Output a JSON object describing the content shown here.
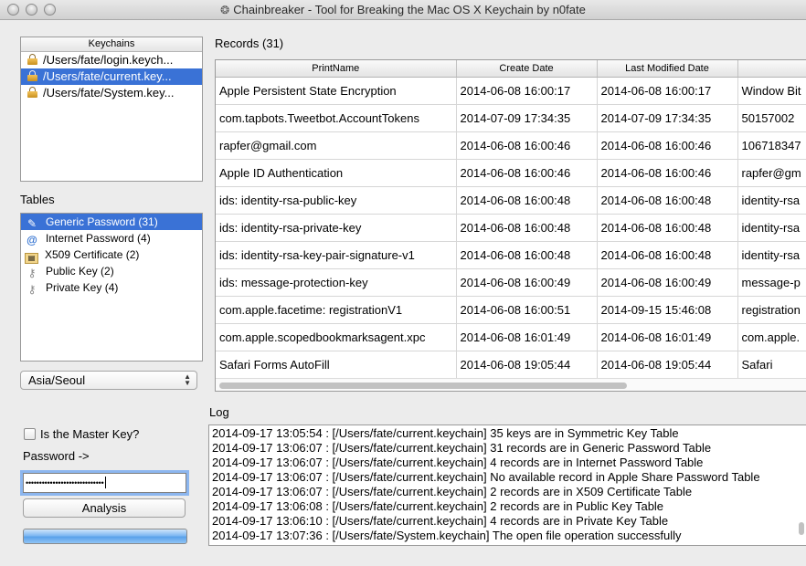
{
  "window": {
    "title": "Chainbreaker - Tool for Breaking the Mac OS X Keychain by n0fate"
  },
  "keychains": {
    "header": "Keychains",
    "items": [
      {
        "label": "/Users/fate/login.keych..."
      },
      {
        "label": "/Users/fate/current.key..."
      },
      {
        "label": "/Users/fate/System.key..."
      }
    ],
    "selected_index": 1
  },
  "tables": {
    "label": "Tables",
    "items": [
      {
        "label": "Generic Password (31)",
        "icon": "pen-icon"
      },
      {
        "label": "Internet Password (4)",
        "icon": "at-icon"
      },
      {
        "label": "X509 Certificate (2)",
        "icon": "certificate-icon"
      },
      {
        "label": "Public Key (2)",
        "icon": "key-icon"
      },
      {
        "label": "Private Key (4)",
        "icon": "key-icon"
      }
    ],
    "selected_index": 0
  },
  "timezone": {
    "value": "Asia/Seoul"
  },
  "records": {
    "label": "Records (31)",
    "columns": [
      "PrintName",
      "Create Date",
      "Last Modified Date",
      ""
    ],
    "rows": [
      [
        "Apple Persistent State Encryption",
        "2014-06-08 16:00:17",
        "2014-06-08 16:00:17",
        "Window Bit"
      ],
      [
        "com.tapbots.Tweetbot.AccountTokens",
        "2014-07-09 17:34:35",
        "2014-07-09 17:34:35",
        "50157002"
      ],
      [
        "rapfer@gmail.com",
        "2014-06-08 16:00:46",
        "2014-06-08 16:00:46",
        "106718347"
      ],
      [
        "Apple ID Authentication",
        "2014-06-08 16:00:46",
        "2014-06-08 16:00:46",
        "rapfer@gm"
      ],
      [
        "ids: identity-rsa-public-key",
        "2014-06-08 16:00:48",
        "2014-06-08 16:00:48",
        "identity-rsa"
      ],
      [
        "ids: identity-rsa-private-key",
        "2014-06-08 16:00:48",
        "2014-06-08 16:00:48",
        "identity-rsa"
      ],
      [
        "ids: identity-rsa-key-pair-signature-v1",
        "2014-06-08 16:00:48",
        "2014-06-08 16:00:48",
        "identity-rsa"
      ],
      [
        "ids: message-protection-key",
        "2014-06-08 16:00:49",
        "2014-06-08 16:00:49",
        "message-p"
      ],
      [
        "com.apple.facetime: registrationV1",
        "2014-06-08 16:00:51",
        "2014-09-15 15:46:08",
        "registration"
      ],
      [
        "com.apple.scopedbookmarksagent.xpc",
        "2014-06-08 16:01:49",
        "2014-06-08 16:01:49",
        "com.apple."
      ],
      [
        "Safari Forms AutoFill",
        "2014-06-08 19:05:44",
        "2014-06-08 19:05:44",
        "Safari"
      ]
    ]
  },
  "log": {
    "label": "Log",
    "lines": [
      "2014-09-17 13:05:54 : [/Users/fate/current.keychain] 35 keys are in Symmetric Key Table",
      "2014-09-17 13:06:07 : [/Users/fate/current.keychain] 31 records are in Generic Password Table",
      "2014-09-17 13:06:07 : [/Users/fate/current.keychain] 4 records are in Internet Password Table",
      "2014-09-17 13:06:07 : [/Users/fate/current.keychain] No available record in Apple Share Password Table",
      "2014-09-17 13:06:07 : [/Users/fate/current.keychain] 2 records are in X509 Certificate Table",
      "2014-09-17 13:06:08 : [/Users/fate/current.keychain] 2 records are in Public Key Table",
      "2014-09-17 13:06:10 : [/Users/fate/current.keychain] 4 records are in Private Key Table",
      "2014-09-17 13:07:36 : [/Users/fate/System.keychain] The open file operation successfully"
    ]
  },
  "auth": {
    "master_key_label": "Is the Master Key?",
    "master_key_checked": false,
    "password_label": "Password ->",
    "password_masked": "•••••••••••••••••••••••••••••",
    "analysis_button": "Analysis",
    "progress_fraction": 1.0
  },
  "colors": {
    "selection": "#3a72d6",
    "focus_ring": "#8cb6ef",
    "progress": "#5aa1ea"
  }
}
